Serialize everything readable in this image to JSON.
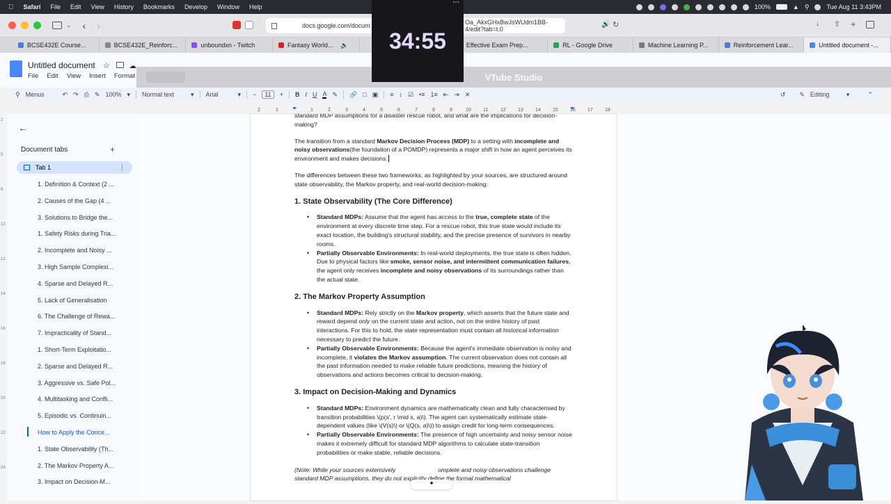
{
  "menubar": {
    "app": "Safari",
    "items": [
      "File",
      "Edit",
      "View",
      "History",
      "Bookmarks",
      "Develop",
      "Window",
      "Help"
    ],
    "battery": "100%",
    "clock": "Tue Aug 11  3:43PM"
  },
  "browser": {
    "url": "docs.google.com/docum",
    "url_tail": "Oa_AkxGHxBwJsWUdm1BB-4/edit?tab=t.0",
    "tabs": [
      {
        "label": "BCSE432E Course...",
        "color": "#4c7bd9"
      },
      {
        "label": "BCSE432E_Reinforc...",
        "color": "#888"
      },
      {
        "label": "unboundxn - Twitch",
        "color": "#9146ff"
      },
      {
        "label": "Fantasy World...",
        "color": "#e02020"
      },
      {
        "label": "Effective Exam Prep...",
        "color": "#e02020"
      },
      {
        "label": "RL - Google Drive",
        "color": "#1fa463"
      },
      {
        "label": "Machine Learning P...",
        "color": "#7a7a7a"
      },
      {
        "label": "Reinforcement Lear...",
        "color": "#4c7bd9"
      },
      {
        "label": "Untitled document -...",
        "color": "#4a86f5"
      }
    ]
  },
  "docs": {
    "title": "Untitled document",
    "menu": [
      "File",
      "Edit",
      "View",
      "Insert",
      "Format"
    ],
    "toolbar": {
      "menus": "Menus",
      "zoom": "100%",
      "style": "Normal text",
      "font": "Arial",
      "size": "11",
      "mode": "Editing"
    }
  },
  "overlay": {
    "vtube_title": "VTube Studio",
    "timer": "34:55"
  },
  "sidebar": {
    "header": "Document tabs",
    "tab": "Tab 1",
    "outline": [
      "1. Definition & Context (2 ...",
      "2. Causes of the Gap (4 ...",
      "3. Solutions to Bridge the...",
      "1. Safety Risks during Tria...",
      "2. Incomplete and Noisy ...",
      "3. High Sample Complexi...",
      "4. Sparse and Delayed R...",
      "5. Lack of Generalisation",
      "6. The Challenge of Rewa...",
      "7. Impracticality of Stand...",
      "1. Short-Term Exploitatio...",
      "2. Sparse and Delayed R...",
      "3. Aggressive vs. Safe Pol...",
      "4. Multitasking and Confli...",
      "5. Episodic vs. Continuin...",
      "How to Apply the Conce...",
      "1. State Observability (Th...",
      "2. The Markov Property A...",
      "3. Impact on Decision-M..."
    ],
    "highlight_index": 15
  },
  "content": {
    "top_partial": "standard MDP assumptions for a disaster rescue robot, and what are the implications for decision-making?",
    "p1_a": "The transition from a standard ",
    "p1_b": "Markov Decision Process (MDP)",
    "p1_c": " to a setting with ",
    "p1_d": "incomplete and noisy observations",
    "p1_e": "(the foundation of a POMDP) represents a major shift in how an agent perceives its environment and makes decisions.",
    "p2": "The differences between these two frameworks, as highlighted by your sources, are structured around state observability, the Markov property, and real-world decision-making:",
    "h1": "1. State Observability (The Core Difference)",
    "s1_b1_label": "Standard MDPs:",
    "s1_b1_text_a": " Assume that the agent has access to the ",
    "s1_b1_bold": "true, complete state",
    "s1_b1_text_b": " of the environment at every discrete time step. For a rescue robot, this true state would include its exact location, the building's structural stability, and the precise presence of survivors in nearby rooms.",
    "s1_b2_label": "Partially Observable Environments:",
    "s1_b2_text_a": " In real-world deployments, the true state is often hidden. Due to physical factors like ",
    "s1_b2_bold": "smoke, sensor noise, and intermittent communication failures",
    "s1_b2_text_b": ", the agent only receives ",
    "s1_b2_bold2": "incomplete and noisy observations",
    "s1_b2_text_c": " of its surroundings rather than the actual state.",
    "h2": "2. The Markov Property Assumption",
    "s2_b1_label": "Standard MDPs:",
    "s2_b1_text_a": " Rely strictly on the ",
    "s2_b1_bold": "Markov property",
    "s2_b1_text_b": ", which asserts that the future state and reward depend ",
    "s2_b1_ital": "only",
    "s2_b1_text_c": " on the current state and action, not on the entire history of past interactions. For this to hold, the state representation must contain all historical information necessary to predict the future.",
    "s2_b2_label": "Partially Observable Environments:",
    "s2_b2_text_a": " Because the agent's immediate observation is noisy and incomplete, it ",
    "s2_b2_bold": "violates the Markov assumption",
    "s2_b2_text_b": ". The current observation does not contain all the past information needed to make reliable future predictions, meaning the history of observations and actions becomes critical to decision-making.",
    "h3": "3. Impact on Decision-Making and Dynamics",
    "s3_b1_label": "Standard MDPs:",
    "s3_b1_text": " Environment dynamics are mathematically clean and fully characterised by transition probabilities \\(p(s', r \\mid s, a)\\). The agent can systematically estimate state-dependent values (like \\(V(s)\\) or \\(Q(s, a)\\)) to assign credit for long-term consequences.",
    "s3_b2_label": "Partially Observable Environments:",
    "s3_b2_text": " The presence of high uncertainty and noisy sensor noise makes it extremely difficult for standard MDP algorithms to calculate state-transition probabilities or make stable, reliable decisions.",
    "note_a": "(Note: While your sources extensively",
    "note_b": "omplete and noisy observations",
    "note_c": "challenge standard MDP assumptions, they do not explicitly define the formal mathematical"
  }
}
